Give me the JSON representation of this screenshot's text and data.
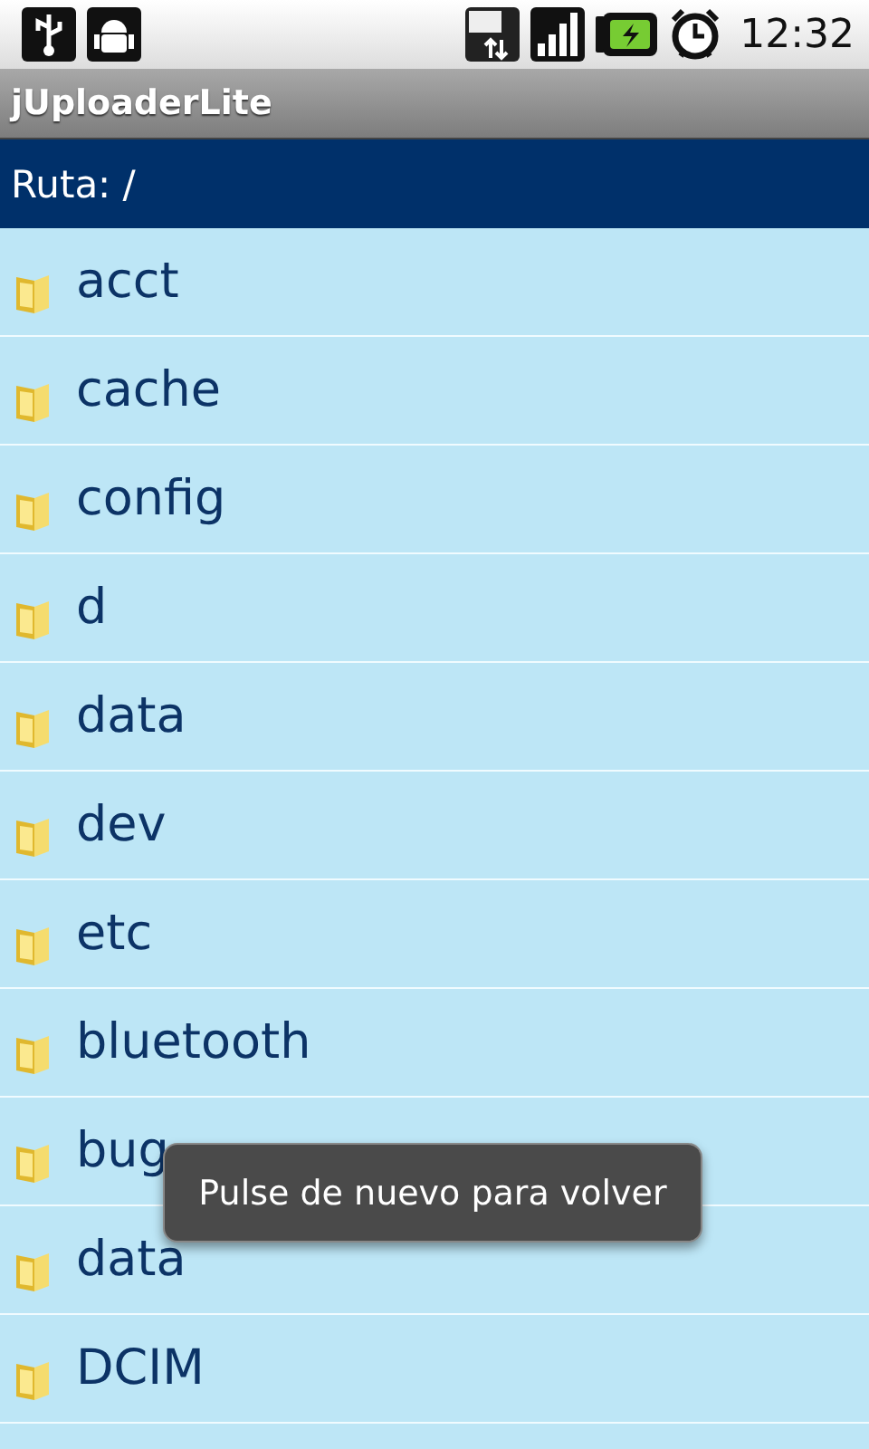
{
  "status_bar": {
    "time": "12:32"
  },
  "window": {
    "title": "jUploaderLite"
  },
  "path": "Ruta: /",
  "folders": [
    {
      "name": "acct"
    },
    {
      "name": "cache"
    },
    {
      "name": "config"
    },
    {
      "name": "d"
    },
    {
      "name": "data"
    },
    {
      "name": "dev"
    },
    {
      "name": "etc"
    },
    {
      "name": "bluetooth"
    },
    {
      "name": "bug"
    },
    {
      "name": "data"
    },
    {
      "name": "DCIM"
    }
  ],
  "toast": "Pulse de nuevo para volver"
}
